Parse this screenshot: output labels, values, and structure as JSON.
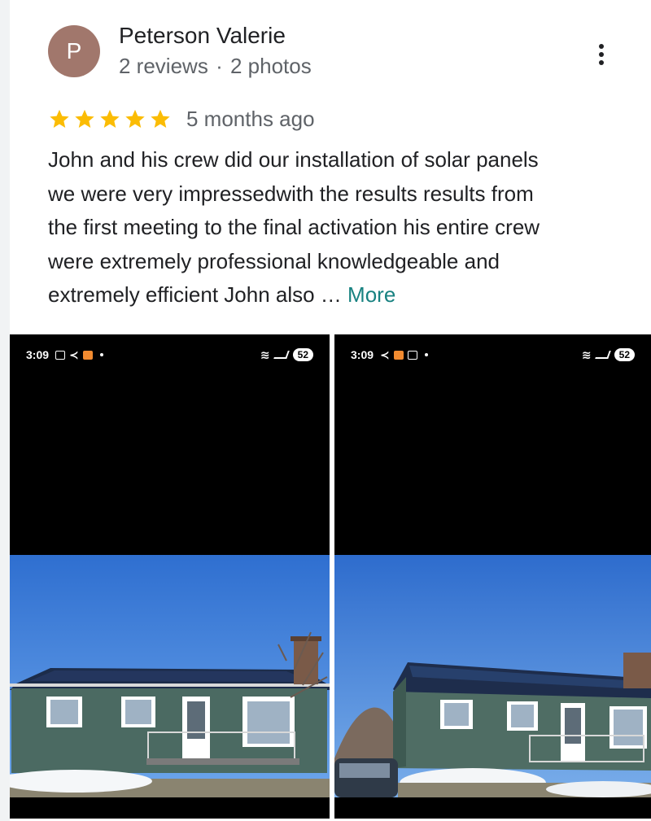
{
  "reviewer": {
    "initial": "P",
    "name": "Peterson Valerie",
    "reviews": "2 reviews",
    "separator": "·",
    "photos": "2 photos",
    "avatar_color": "#a1776c"
  },
  "rating": {
    "stars": 5,
    "max": 5,
    "star_color": "#fbbc04"
  },
  "time_ago": "5 months ago",
  "review_lines": [
    "John and his crew did our installation of solar panels",
    "we were very impressedwith the results results from",
    "the first meeting to the final activation his entire crew",
    "were extremely professional knowledgeable and",
    "extremely efficient John also …"
  ],
  "more_link": "More",
  "photos": [
    {
      "clock": "3:09",
      "battery": "52"
    },
    {
      "clock": "3:09",
      "battery": "52"
    }
  ]
}
